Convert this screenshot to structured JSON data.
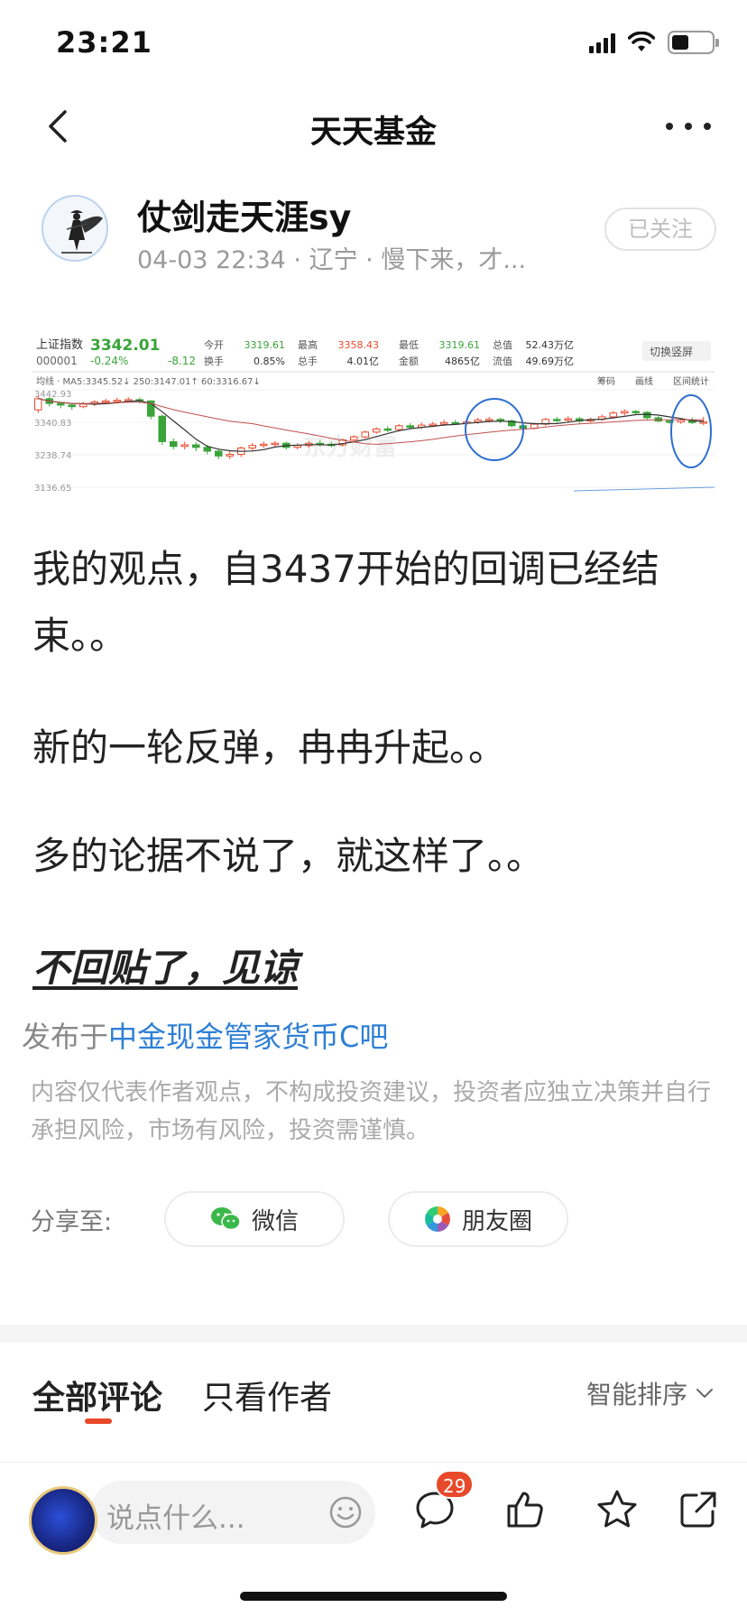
{
  "status_bar": {
    "time": "23:21"
  },
  "nav": {
    "title": "天天基金"
  },
  "author": {
    "name": "仗剑走天涯sy",
    "meta": "04-03 22:34 · 辽宁 · 慢下来，才...",
    "follow_label": "已关注"
  },
  "chart_data": {
    "type": "candlestick",
    "index_name": "上证指数",
    "index_code": "000001",
    "price": "3342.01",
    "change_pct": "-0.24%",
    "change": "-8.12",
    "stats": [
      {
        "label": "今开",
        "value": "3319.61"
      },
      {
        "label": "最高",
        "value": "3358.43"
      },
      {
        "label": "最低",
        "value": "3319.61"
      },
      {
        "label": "总值",
        "value": "52.43万亿"
      },
      {
        "label": "换手",
        "value": "0.85%"
      },
      {
        "label": "总手",
        "value": "4.01亿"
      },
      {
        "label": "金额",
        "value": "4865亿"
      },
      {
        "label": "流值",
        "value": "49.69万亿"
      }
    ],
    "switch_label": "切换竖屏",
    "ma_line": "均线 · MA5:3345.52↓ 250:3147.01↑ 60:3316.67↓",
    "toolbar": [
      "筹码",
      "画线",
      "区间统计"
    ],
    "y_ticks": [
      "3442.93",
      "3340.83",
      "3238.74",
      "3136.65"
    ],
    "ylim": [
      3136.65,
      3442.93
    ],
    "watermark": "东方财富",
    "candles": [
      [
        3380,
        3415,
        3425,
        3370
      ],
      [
        3415,
        3400,
        3420,
        3390
      ],
      [
        3400,
        3395,
        3405,
        3385
      ],
      [
        3395,
        3390,
        3400,
        3380
      ],
      [
        3390,
        3398,
        3405,
        3385
      ],
      [
        3398,
        3405,
        3410,
        3392
      ],
      [
        3405,
        3408,
        3415,
        3400
      ],
      [
        3408,
        3410,
        3418,
        3402
      ],
      [
        3410,
        3412,
        3420,
        3405
      ],
      [
        3412,
        3408,
        3418,
        3400
      ],
      [
        3408,
        3360,
        3410,
        3350
      ],
      [
        3360,
        3280,
        3365,
        3270
      ],
      [
        3280,
        3265,
        3290,
        3255
      ],
      [
        3265,
        3270,
        3280,
        3255
      ],
      [
        3270,
        3262,
        3278,
        3250
      ],
      [
        3262,
        3250,
        3270,
        3240
      ],
      [
        3250,
        3235,
        3258,
        3225
      ],
      [
        3235,
        3240,
        3250,
        3225
      ],
      [
        3240,
        3260,
        3265,
        3232
      ],
      [
        3260,
        3268,
        3275,
        3252
      ],
      [
        3268,
        3272,
        3280,
        3260
      ],
      [
        3272,
        3275,
        3282,
        3265
      ],
      [
        3275,
        3262,
        3280,
        3255
      ],
      [
        3262,
        3268,
        3275,
        3255
      ],
      [
        3268,
        3275,
        3282,
        3260
      ],
      [
        3275,
        3272,
        3285,
        3265
      ],
      [
        3272,
        3270,
        3280,
        3262
      ],
      [
        3270,
        3285,
        3290,
        3265
      ],
      [
        3285,
        3295,
        3300,
        3280
      ],
      [
        3295,
        3310,
        3315,
        3290
      ],
      [
        3310,
        3320,
        3325,
        3305
      ],
      [
        3320,
        3318,
        3328,
        3310
      ],
      [
        3318,
        3330,
        3335,
        3312
      ],
      [
        3330,
        3325,
        3338,
        3320
      ],
      [
        3325,
        3332,
        3340,
        3320
      ],
      [
        3332,
        3335,
        3342,
        3326
      ],
      [
        3335,
        3340,
        3348,
        3330
      ],
      [
        3340,
        3338,
        3348,
        3332
      ],
      [
        3338,
        3342,
        3350,
        3332
      ],
      [
        3342,
        3348,
        3355,
        3336
      ],
      [
        3348,
        3350,
        3358,
        3340
      ],
      [
        3350,
        3345,
        3355,
        3338
      ],
      [
        3345,
        3330,
        3350,
        3325
      ],
      [
        3330,
        3322,
        3338,
        3315
      ],
      [
        3322,
        3335,
        3340,
        3318
      ],
      [
        3335,
        3350,
        3355,
        3330
      ],
      [
        3350,
        3348,
        3358,
        3340
      ],
      [
        3348,
        3352,
        3360,
        3342
      ],
      [
        3352,
        3345,
        3358,
        3338
      ],
      [
        3345,
        3350,
        3356,
        3340
      ],
      [
        3350,
        3358,
        3365,
        3345
      ],
      [
        3358,
        3370,
        3376,
        3352
      ],
      [
        3370,
        3375,
        3382,
        3362
      ],
      [
        3375,
        3372,
        3380,
        3365
      ],
      [
        3372,
        3355,
        3376,
        3350
      ],
      [
        3355,
        3345,
        3360,
        3340
      ],
      [
        3345,
        3342,
        3350,
        3336
      ],
      [
        3342,
        3348,
        3352,
        3336
      ],
      [
        3348,
        3340,
        3356,
        3335
      ],
      [
        3340,
        3342,
        3358,
        3332
      ]
    ]
  },
  "post": {
    "p1": "我的观点，自3437开始的回调已经结束。。",
    "p2": "新的一轮反弹，冉冉升起。。",
    "p3": "多的论据不说了，就这样了。。",
    "p4": "不回贴了，见谅"
  },
  "published": {
    "prefix": "发布于",
    "link": "中金现金管家货币C吧"
  },
  "disclaimer": "内容仅代表作者观点，不构成投资建议，投资者应独立决策并自行承担风险，市场有风险，投资需谨慎。",
  "share": {
    "label": "分享至:",
    "wechat": "微信",
    "moments": "朋友圈"
  },
  "tabs": {
    "all": "全部评论",
    "author_only": "只看作者",
    "sort": "智能排序"
  },
  "bottom": {
    "placeholder": "说点什么...",
    "comment_count": "29"
  },
  "colors": {
    "up": "#e8492b",
    "down": "#3aa43a",
    "link": "#2f7fd5",
    "accent": "#e8492b"
  }
}
